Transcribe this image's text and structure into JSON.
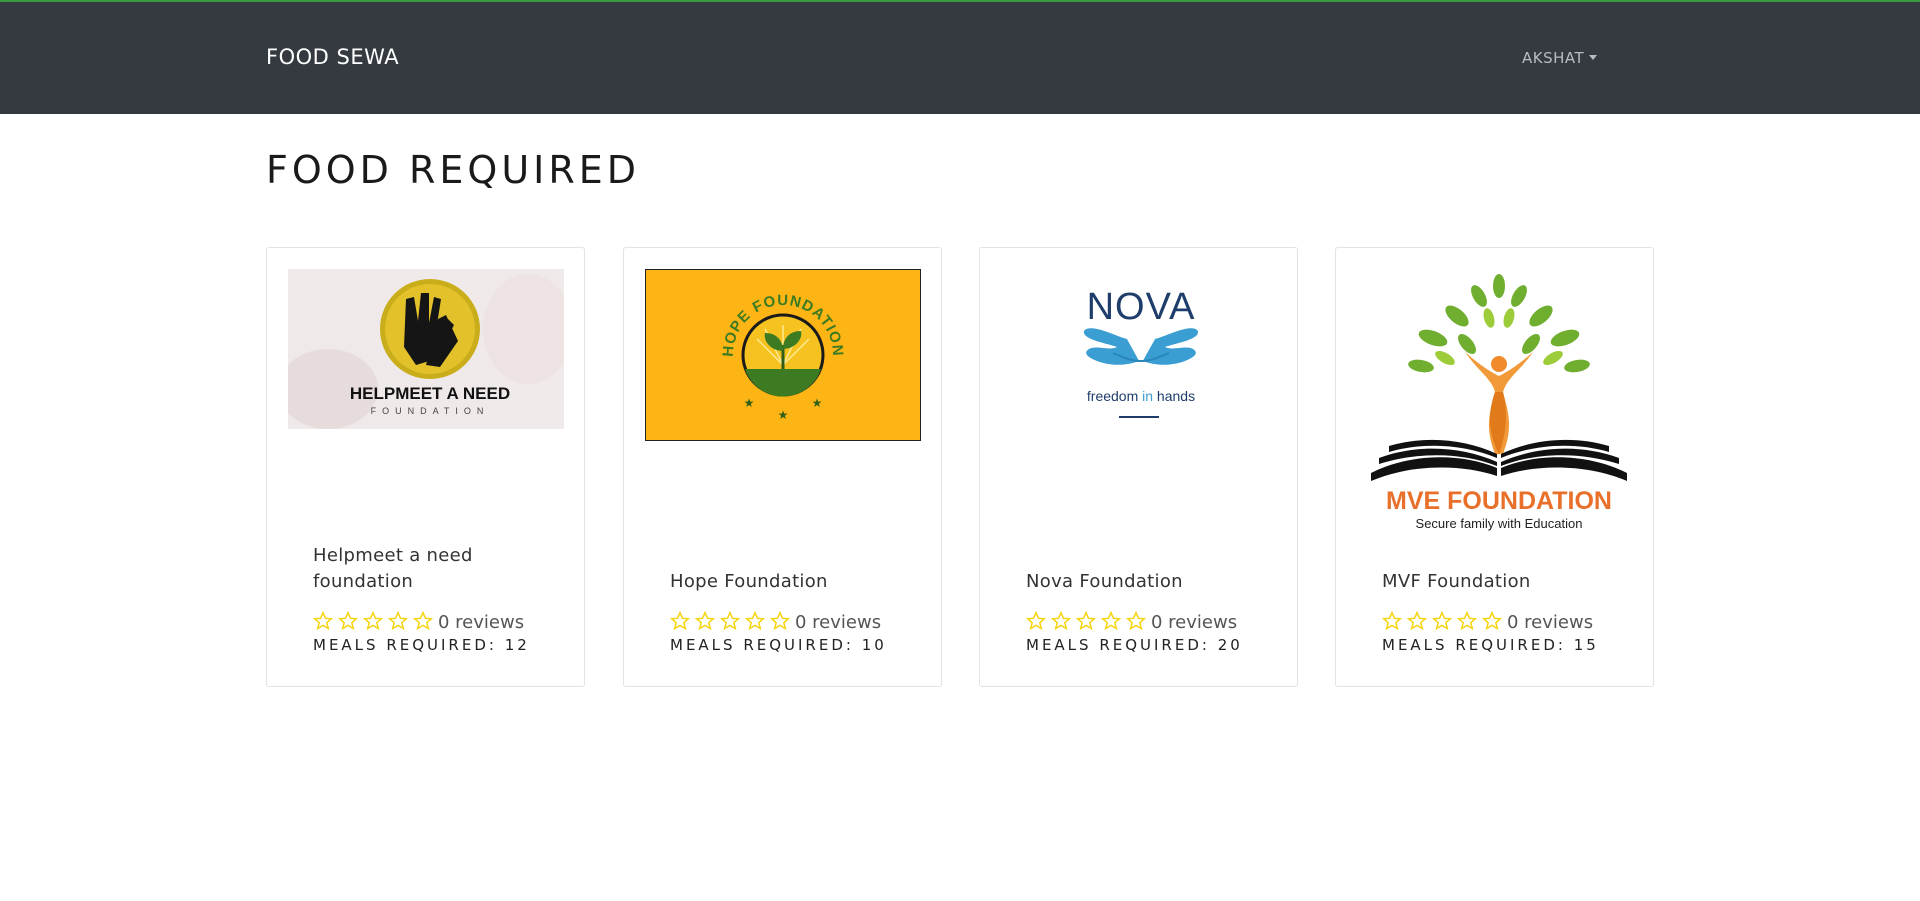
{
  "navbar": {
    "brand": "FOOD SEWA",
    "user": "AKSHAT"
  },
  "page_title": "FOOD REQUIRED",
  "colors": {
    "navbar": "#343a40",
    "star": "#f5d40f",
    "accent_line": "#3a9a3f"
  },
  "cards": [
    {
      "name": "Helpmeet a need foundation",
      "reviews": "0 reviews",
      "meals_label": "MEALS REQUIRED: 12",
      "stars": 0,
      "logo": {
        "title": "HELPMEET A NEED",
        "subtitle": "FOUNDATION"
      }
    },
    {
      "name": "Hope Foundation",
      "reviews": "0 reviews",
      "meals_label": "MEALS REQUIRED: 10",
      "stars": 0,
      "logo": {
        "title": "HOPE FOUNDATION"
      }
    },
    {
      "name": "Nova Foundation",
      "reviews": "0 reviews",
      "meals_label": "MEALS REQUIRED: 20",
      "stars": 0,
      "logo": {
        "title": "NOVA",
        "tagline_a": "freedom ",
        "tagline_b": "in",
        "tagline_c": " hands"
      }
    },
    {
      "name": "MVF Foundation",
      "reviews": "0 reviews",
      "meals_label": "MEALS REQUIRED: 15",
      "stars": 0,
      "logo": {
        "title": "MVE FOUNDATION",
        "tagline": "Secure family with Education"
      }
    }
  ]
}
